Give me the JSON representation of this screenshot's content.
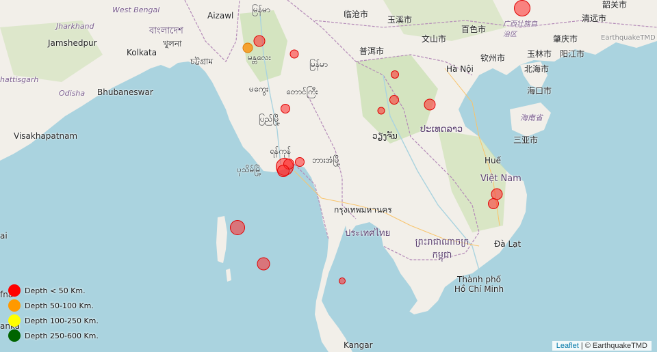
{
  "labels": {
    "west_bengal": "West Bengal",
    "jharkhand": "Jharkhand",
    "chhattisgarh": "hattisgarh",
    "bangladesh": "বাংলাদেশ",
    "khulna": "খুলনা",
    "jamshedpur": "Jamshedpur",
    "kolkata": "Kolkata",
    "chattogram": "চট্টগ্রাম",
    "odisha": "Odisha",
    "bhubaneswar": "Bhubaneswar",
    "visakhapatnam": "Visakhapatnam",
    "aizawl": "Aizawl",
    "myanmar_top": "မြန်မာ",
    "mandalay": "မန္တလေး",
    "magway": "မကွေး",
    "taunggyi": "တောင်ကြီး",
    "pyay": "ပြည်မြို့",
    "yangon": "ရန်ကုန်",
    "pathein": "ပုသိမ်မြို့",
    "hpa_an": "ဘားအံမြို့",
    "myanmar_mid": "မြန်မာ",
    "lincang": "临沧市",
    "yuxi": "玉溪市",
    "wenshan": "文山市",
    "baise": "百色市",
    "guangxi": "广西壮族自治区",
    "puer": "普洱市",
    "hanoi": "Hà Nội",
    "qinzhou": "钦州市",
    "zhaoqing": "肇庆市",
    "yulin": "玉林市",
    "yangjiang": "阳江市",
    "beihai": "北海市",
    "haikou": "海口市",
    "hainan": "海南省",
    "sanya": "三亚市",
    "qingyuan": "清远市",
    "shaoguan": "韶关市",
    "earthquaketmd": "EarthquakeTMD",
    "laos": "ປະເທດລາວ",
    "vientiane": "ວຽງຈັນ",
    "hue": "Huế",
    "vietnam": "Việt Nam",
    "bangkok": "กรุงเทพมหานคร",
    "thailand": "ประเทศไทย",
    "cambodia": "ព្រះរាជាណាចក្រ កម្ពុជា",
    "dalat": "Đà Lạt",
    "hcmc": "Thành phố Hồ Chí Minh",
    "kangar": "Kangar",
    "left_ai": "ai",
    "left_fna": "fna",
    "left_lanka": "anka"
  },
  "legend": [
    {
      "label": "Depth < 50 Km.",
      "color": "#ff0000"
    },
    {
      "label": "Depth 50-100 Km.",
      "color": "#ff9900"
    },
    {
      "label": "Depth 100-250 Km.",
      "color": "#ffff00"
    },
    {
      "label": "Depth 250-600 Km.",
      "color": "#006400"
    }
  ],
  "attribution": {
    "leaflet": "Leaflet",
    "separator": " | ",
    "source": "© EarthquakeTMD"
  }
}
